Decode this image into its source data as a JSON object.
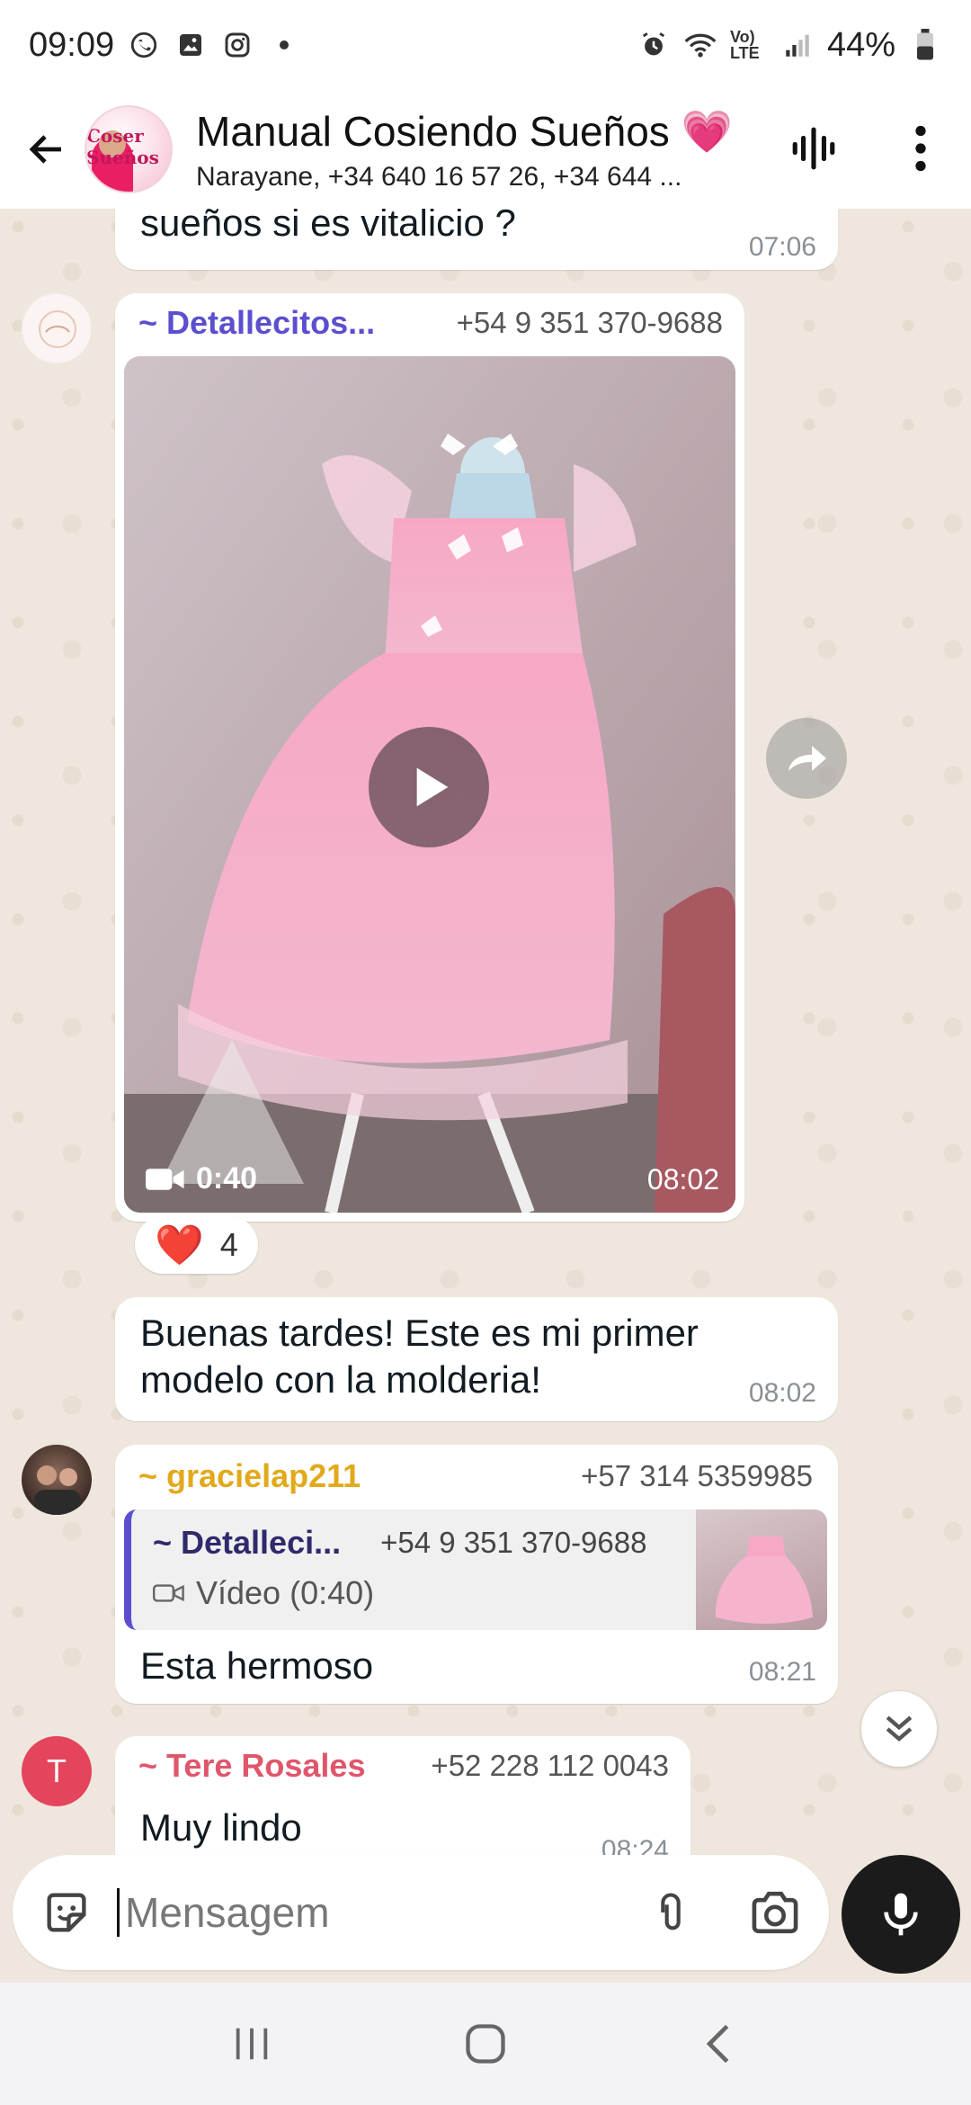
{
  "status_bar": {
    "time": "09:09",
    "battery": "44%",
    "network": "Vo) LTE",
    "left_icons": [
      "whatsapp-icon",
      "gallery-icon",
      "instagram-icon",
      "dot-icon"
    ],
    "right_icons": [
      "alarm-icon",
      "wifi-icon",
      "signal-icon",
      "battery-icon"
    ]
  },
  "header": {
    "title": "Manual Cosiendo Sueños",
    "title_emoji": "💗",
    "subtitle": "Narayane, +34 640 16 57 26, +34 644 ...",
    "avatar_text": "Coser Sueños"
  },
  "messages": {
    "m1": {
      "text": "sueños si es vitalicio ?",
      "time": "07:06"
    },
    "m2": {
      "sender": "~ Detallecitos...",
      "phone": "+54 9 351 370-9688",
      "sender_color": "#5b4fcf",
      "video_duration": "0:40",
      "time": "08:02",
      "reaction_emoji": "❤️",
      "reaction_count": "4"
    },
    "m3": {
      "text": "Buenas tardes! Este es mi primer modelo con la molderia!",
      "time": "08:02"
    },
    "m4": {
      "sender": "~ gracielap211",
      "phone": "+57 314 5359985",
      "sender_color": "#e2a91b",
      "quote_sender": "~ Detalleci...",
      "quote_phone": "+54 9 351 370-9688",
      "quote_text": "Vídeo (0:40)",
      "text": "Esta hermoso",
      "time": "08:21"
    },
    "m5": {
      "sender": "~ Tere Rosales",
      "phone": "+52 228 112 0043",
      "sender_color": "#e0566b",
      "avatar_letter": "T",
      "text": "Muy lindo",
      "time": "08:24"
    }
  },
  "composer": {
    "placeholder": "Mensagem"
  },
  "colors": {
    "mic_button": "#1b1b1b",
    "chat_bg": "#efe7dd",
    "bubble": "#ffffff"
  }
}
